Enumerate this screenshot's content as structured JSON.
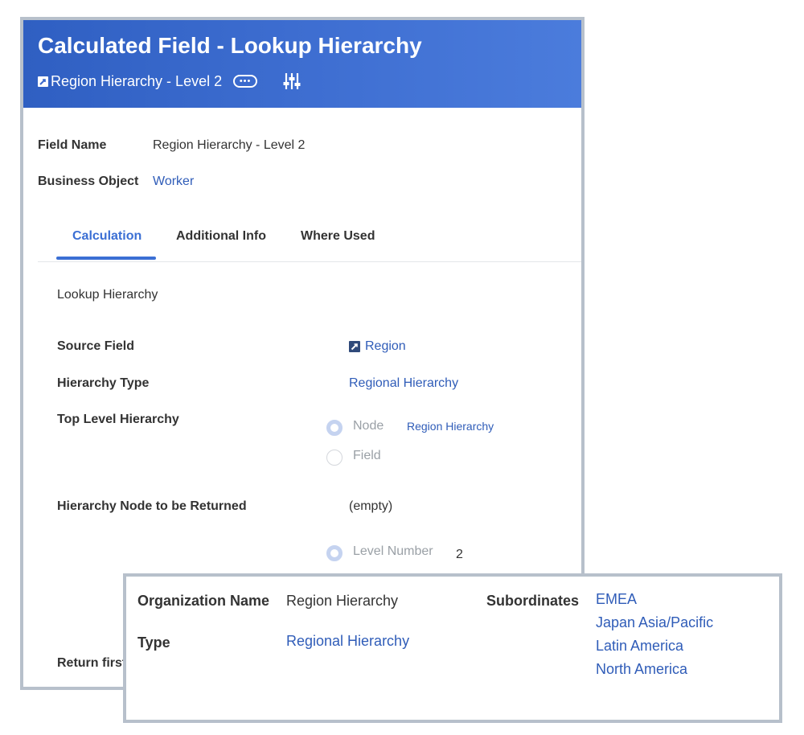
{
  "header": {
    "title": "Calculated Field - Lookup Hierarchy",
    "subtitle": "Region Hierarchy - Level 2",
    "more_icon": "ellipsis-icon",
    "settings_icon": "sliders-icon",
    "bg_color": "#3a69cc"
  },
  "fields": {
    "field_name_label": "Field Name",
    "field_name_value": "Region Hierarchy - Level 2",
    "business_object_label": "Business Object",
    "business_object_value": "Worker"
  },
  "tabs": [
    {
      "label": "Calculation",
      "active": true
    },
    {
      "label": "Additional Info",
      "active": false
    },
    {
      "label": "Where Used",
      "active": false
    }
  ],
  "calculation": {
    "section_title": "Lookup Hierarchy",
    "source_field_label": "Source Field",
    "source_field_value": "Region",
    "hierarchy_type_label": "Hierarchy Type",
    "hierarchy_type_value": "Regional Hierarchy",
    "top_level_label": "Top Level Hierarchy",
    "top_level_options": [
      {
        "label": "Node",
        "selected": true
      },
      {
        "label": "Field",
        "selected": false
      }
    ],
    "top_level_node_value": "Region Hierarchy",
    "node_returned_label": "Hierarchy Node to be Returned",
    "node_returned_value": "(empty)",
    "level_option_label": "Level Number",
    "level_option_selected": true,
    "level_number_value": "2",
    "return_first_label": "Return first"
  },
  "popup": {
    "org_name_label": "Organization Name",
    "org_name_value": "Region Hierarchy",
    "type_label": "Type",
    "type_value": "Regional Hierarchy",
    "subordinates_label": "Subordinates",
    "subordinates": [
      "EMEA",
      "Japan Asia/Pacific",
      "Latin America",
      "North America"
    ]
  },
  "colors": {
    "link": "#2f5cb8",
    "accent": "#3b6fd4",
    "border": "#b7c0cb"
  }
}
